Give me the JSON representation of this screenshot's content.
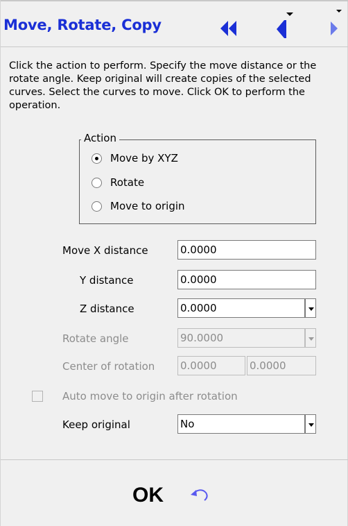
{
  "header": {
    "title": "Move, Rotate, Copy"
  },
  "description": "Click the action to perform. Specify the move distance or the rotate angle. Keep original will create copies of the selected curves. Select the curves to move. Click OK to perform the operation.",
  "action_group": {
    "legend": "Action",
    "options": [
      "Move by XYZ",
      "Rotate",
      "Move to origin"
    ],
    "selected": "Move by XYZ"
  },
  "fields": {
    "move_x": {
      "label": "Move X distance",
      "value": "0.0000"
    },
    "move_y": {
      "label": "Y distance",
      "value": "0.0000"
    },
    "move_z": {
      "label": "Z distance",
      "value": "0.0000"
    },
    "rotate_angle": {
      "label": "Rotate angle",
      "value": "90.0000"
    },
    "center": {
      "label": "Center of rotation",
      "x": "0.0000",
      "y": "0.0000"
    },
    "auto_move": {
      "label": "Auto move to origin after rotation",
      "checked": false
    },
    "keep_original": {
      "label": "Keep original",
      "value": "No"
    }
  },
  "footer": {
    "ok_label": "OK"
  },
  "colors": {
    "title": "#1a2fd6",
    "nav_icon": "#1a2fd6",
    "undo_icon": "#5a5af0",
    "disabled_text": "#8c8c8c"
  },
  "icons": {
    "nav_first": "rewind-icon",
    "nav_prev": "prev-icon",
    "nav_next": "next-icon",
    "undo": "undo-icon"
  }
}
